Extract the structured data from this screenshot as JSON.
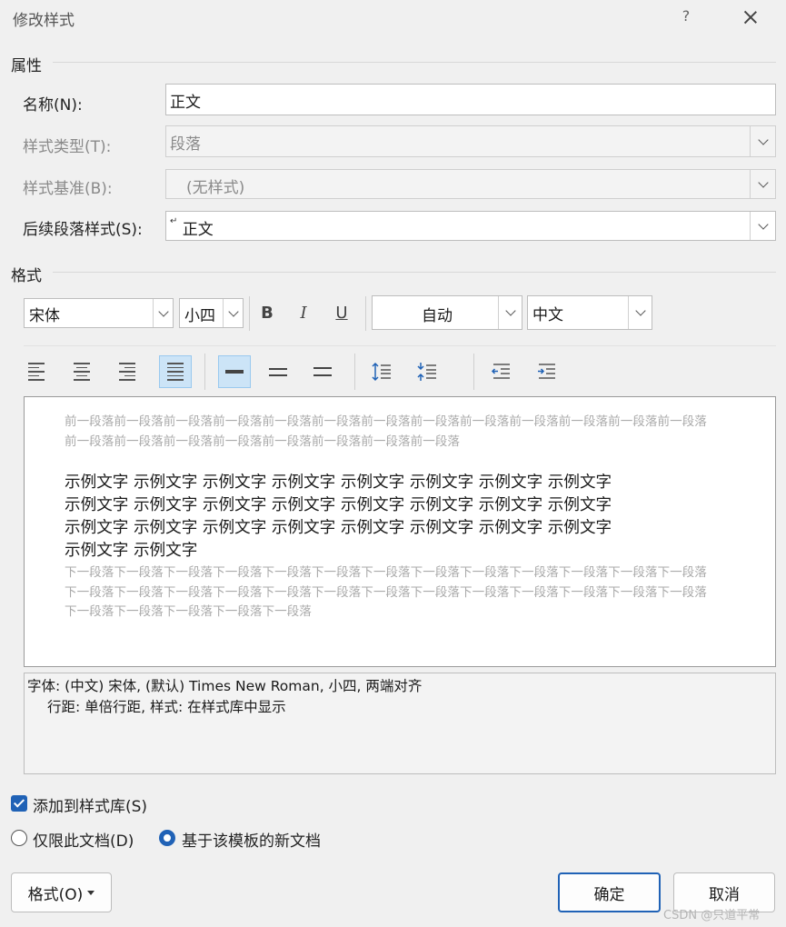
{
  "window": {
    "title": "修改样式",
    "help": "?"
  },
  "properties": {
    "section_label": "属性",
    "name_label": "名称(N):",
    "name_value": "正文",
    "style_type_label": "样式类型(T):",
    "style_type_value": "段落",
    "based_on_label": "样式基准(B):",
    "based_on_value": "(无样式)",
    "next_style_label": "后续段落样式(S):",
    "next_style_value": "正文",
    "next_style_icon": "paragraph-mark-icon"
  },
  "format": {
    "section_label": "格式",
    "font": "宋体",
    "size": "小四",
    "bold": "B",
    "italic": "I",
    "underline": "U",
    "color": "自动",
    "script": "中文"
  },
  "preview": {
    "prev_para": "前一段落前一段落前一段落前一段落前一段落前一段落前一段落前一段落前一段落前一段落前一段落前一段落前一段落前一段落前一段落前一段落前一段落前一段落前一段落前一段落前一段落",
    "sample_lines": [
      "示例文字  示例文字  示例文字  示例文字  示例文字  示例文字  示例文字  示例文字",
      "示例文字  示例文字  示例文字  示例文字  示例文字  示例文字  示例文字  示例文字",
      "示例文字  示例文字  示例文字  示例文字  示例文字  示例文字  示例文字  示例文字",
      "示例文字  示例文字"
    ],
    "next_para": "下一段落下一段落下一段落下一段落下一段落下一段落下一段落下一段落下一段落下一段落下一段落下一段落下一段落下一段落下一段落下一段落下一段落下一段落下一段落下一段落下一段落下一段落下一段落下一段落下一段落下一段落下一段落下一段落下一段落下一段落下一段落"
  },
  "description": {
    "line1": "字体: (中文) 宋体, (默认) Times New Roman, 小四, 两端对齐",
    "line2": "行距: 单倍行距, 样式: 在样式库中显示"
  },
  "options": {
    "add_to_gallery": "添加到样式库(S)",
    "add_to_gallery_checked": true,
    "this_doc_only": "仅限此文档(D)",
    "new_docs": "基于该模板的新文档",
    "selected_scope": "new_docs"
  },
  "buttons": {
    "format": "格式(O)",
    "ok": "确定",
    "cancel": "取消"
  },
  "watermark": "CSDN @只道平常",
  "colors": {
    "accent": "#2062b6",
    "active_bg": "#cce4f7"
  }
}
